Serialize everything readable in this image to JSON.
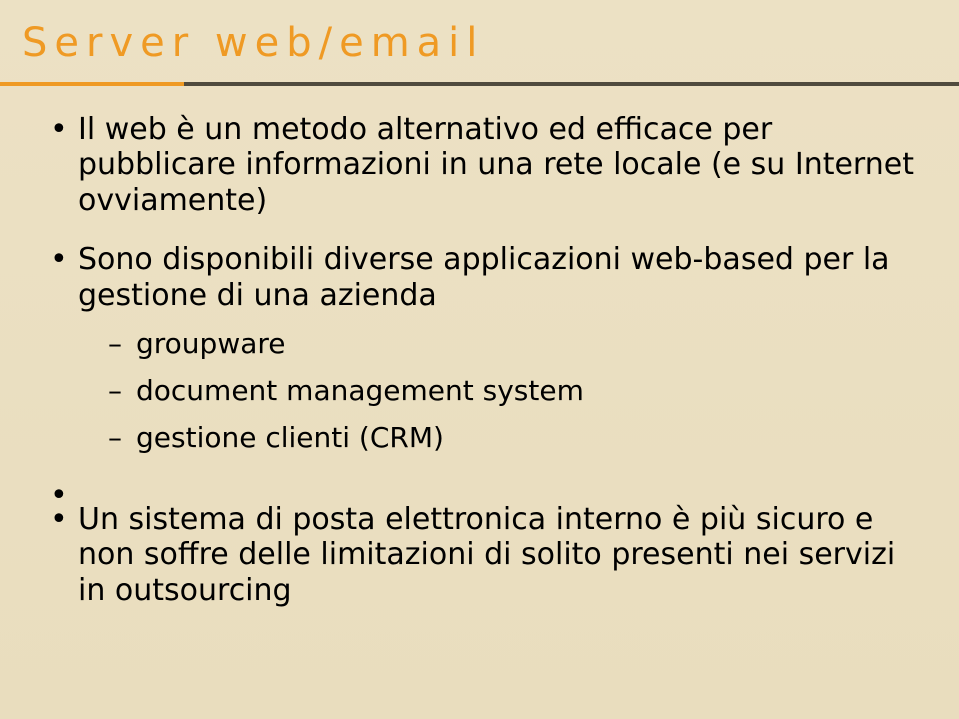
{
  "title": "Server web/email",
  "bullets": {
    "b1": "Il web è un metodo alternativo ed efficace per pubblicare informazioni in una rete locale (e su Internet ovviamente)",
    "b2": "Sono disponibili diverse applicazioni web-based per la gestione di una azienda",
    "b2_sub1": "groupware",
    "b2_sub2": "document management system",
    "b2_sub3": "gestione clienti (CRM)",
    "b3": "Un sistema di posta elettronica interno è più sicuro e non soffre delle limitazioni di solito presenti nei servizi in outsourcing"
  }
}
